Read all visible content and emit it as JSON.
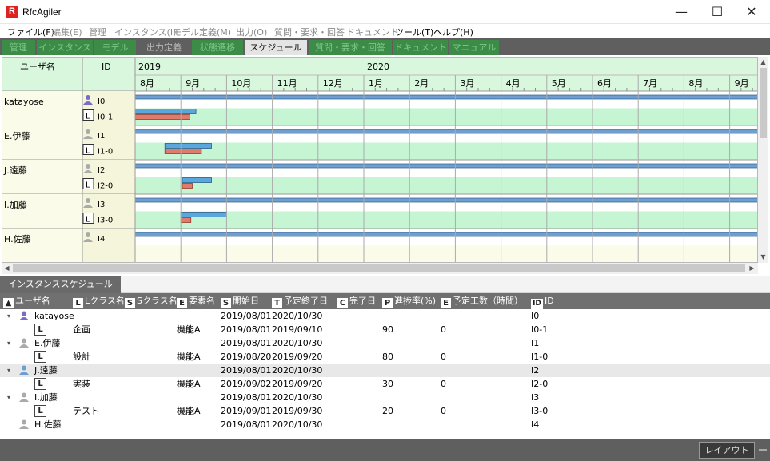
{
  "app": {
    "title": "RfcAgiler",
    "logo": "R"
  },
  "window_controls": {
    "minimize": "—",
    "maximize": "☐",
    "close": "✕"
  },
  "menu": [
    {
      "label": "ファイル(F)",
      "enabled": true
    },
    {
      "label": "編集(E)",
      "enabled": false
    },
    {
      "label": "管理",
      "enabled": false
    },
    {
      "label": "インスタンス(I)",
      "enabled": false
    },
    {
      "label": "モデル定義(M)",
      "enabled": false
    },
    {
      "label": "出力(O)",
      "enabled": false
    },
    {
      "label": "質問・要求・回答",
      "enabled": false
    },
    {
      "label": "ドキュメント",
      "enabled": false
    },
    {
      "label": "ツール(T)",
      "enabled": true
    },
    {
      "label": "ヘルプ(H)",
      "enabled": true
    }
  ],
  "tabs": [
    {
      "label": "管理",
      "state": "green"
    },
    {
      "label": "インスタンス",
      "state": "green"
    },
    {
      "label": "モデル",
      "state": "green"
    },
    {
      "label": "出力定義",
      "state": "gray"
    },
    {
      "label": "状態遷移",
      "state": "green"
    },
    {
      "label": "スケジュール",
      "state": "active"
    },
    {
      "label": "質問・要求・回答",
      "state": "green"
    },
    {
      "label": "ドキュメント",
      "state": "green"
    },
    {
      "label": "マニュアル",
      "state": "green"
    }
  ],
  "gantt": {
    "col_user": "ユーザ名",
    "col_id": "ID",
    "years": [
      {
        "label": "2019",
        "month_index": 0
      },
      {
        "label": "2020",
        "month_index": 5
      }
    ],
    "months": [
      "8月",
      "9月",
      "10月",
      "11月",
      "12月",
      "1月",
      "2月",
      "3月",
      "4月",
      "5月",
      "6月",
      "7月",
      "8月",
      "9月"
    ],
    "users": [
      {
        "name": "katayose",
        "icon": "user-purple",
        "parent_id": "I0",
        "child_id": "I0-1",
        "plan": [
          0.0,
          1.33
        ],
        "actual": [
          0.0,
          1.2
        ]
      },
      {
        "name": "E.伊藤",
        "icon": "user-gray",
        "parent_id": "I1",
        "child_id": "I1-0",
        "plan": [
          0.65,
          1.67
        ],
        "actual": [
          0.65,
          1.45
        ]
      },
      {
        "name": "J.遠藤",
        "icon": "user-gray",
        "parent_id": "I2",
        "child_id": "I2-0",
        "plan": [
          1.03,
          1.67
        ],
        "actual": [
          1.03,
          1.25
        ]
      },
      {
        "name": "I.加藤",
        "icon": "user-gray",
        "parent_id": "I3",
        "child_id": "I3-0",
        "plan": [
          1.0,
          2.0
        ],
        "actual": [
          1.0,
          1.22
        ]
      },
      {
        "name": "H.佐藤",
        "icon": "user-gray",
        "parent_id": "I4",
        "child_id": null,
        "plan": null,
        "actual": null
      }
    ],
    "colors": {
      "header_bg": "#d9f7dc",
      "row_bg": "#c6f5d4",
      "left_bg": "#fbfbe9",
      "plan_bar": "#5aa7dd",
      "actual_bar": "#e07a6a",
      "parent_bar": "#6e9fd0"
    }
  },
  "lower": {
    "tab_label": "インスタンススケジュール",
    "columns": [
      {
        "icon": "user-icon",
        "label": "ユーザ名"
      },
      {
        "icon": "L",
        "label": "Lクラス名"
      },
      {
        "icon": "S",
        "label": "Sクラス名"
      },
      {
        "icon": "E",
        "label": "要素名"
      },
      {
        "icon": "S",
        "label": "開始日"
      },
      {
        "icon": "T",
        "label": "予定終了日"
      },
      {
        "icon": "C",
        "label": "完了日"
      },
      {
        "icon": "P",
        "label": "進捗率(%)"
      },
      {
        "icon": "E",
        "label": "予定工数（時間）"
      },
      {
        "icon": "ID",
        "label": "ID"
      }
    ],
    "rows": [
      {
        "type": "user",
        "expander": "▾",
        "user": "katayose",
        "icon": "user-purple",
        "start": "2019/08/01",
        "end": "2020/10/30",
        "id": "I0",
        "selected": false
      },
      {
        "type": "task",
        "lclass": "企画",
        "element": "機能A",
        "start": "2019/08/01",
        "end": "2019/09/10",
        "progress": "90",
        "effort": "0",
        "id": "I0-1"
      },
      {
        "type": "user",
        "expander": "▾",
        "user": "E.伊藤",
        "icon": "user-gray",
        "start": "2019/08/01",
        "end": "2020/10/30",
        "id": "I1",
        "selected": false
      },
      {
        "type": "task",
        "lclass": "設計",
        "element": "機能A",
        "start": "2019/08/20",
        "end": "2019/09/20",
        "progress": "80",
        "effort": "0",
        "id": "I1-0"
      },
      {
        "type": "user",
        "expander": "▾",
        "user": "J.遠藤",
        "icon": "user-blue",
        "start": "2019/08/01",
        "end": "2020/10/30",
        "id": "I2",
        "selected": true
      },
      {
        "type": "task",
        "lclass": "実装",
        "element": "機能A",
        "start": "2019/09/02",
        "end": "2019/09/20",
        "progress": "30",
        "effort": "0",
        "id": "I2-0"
      },
      {
        "type": "user",
        "expander": "▾",
        "user": "I.加藤",
        "icon": "user-gray",
        "start": "2019/08/01",
        "end": "2020/10/30",
        "id": "I3",
        "selected": false
      },
      {
        "type": "task",
        "lclass": "テスト",
        "element": "機能A",
        "start": "2019/09/01",
        "end": "2019/09/30",
        "progress": "20",
        "effort": "0",
        "id": "I3-0"
      },
      {
        "type": "user",
        "expander": "",
        "user": "H.佐藤",
        "icon": "user-gray",
        "start": "2019/08/01",
        "end": "2020/10/30",
        "id": "I4",
        "selected": false
      }
    ]
  },
  "status": {
    "layout_button": "レイアウト"
  }
}
